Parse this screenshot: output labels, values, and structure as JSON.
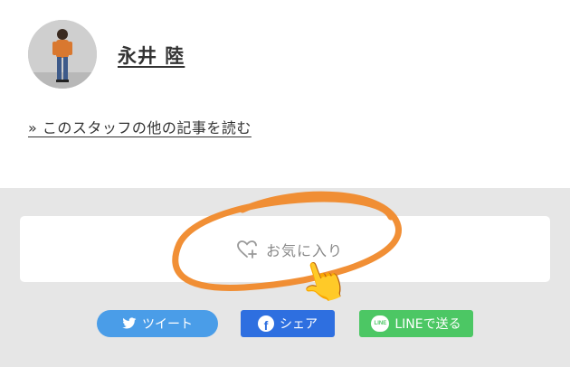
{
  "staff": {
    "name": "永井 陸",
    "other_articles_link": "» このスタッフの他の記事を読む"
  },
  "favorite": {
    "label": "お気に入り",
    "icon": "heart-plus-icon"
  },
  "share": {
    "twitter_label": "ツイート",
    "facebook_label": "シェア",
    "facebook_icon_text": "f",
    "line_label": "LINEで送る",
    "line_badge_text": "LINE"
  },
  "annotation": {
    "hand_glyph": "👆",
    "circle_color": "#f0892a"
  },
  "colors": {
    "twitter": "#4a9de8",
    "facebook": "#2e6fe0",
    "line": "#4cc764",
    "band": "#e6e6e6"
  }
}
